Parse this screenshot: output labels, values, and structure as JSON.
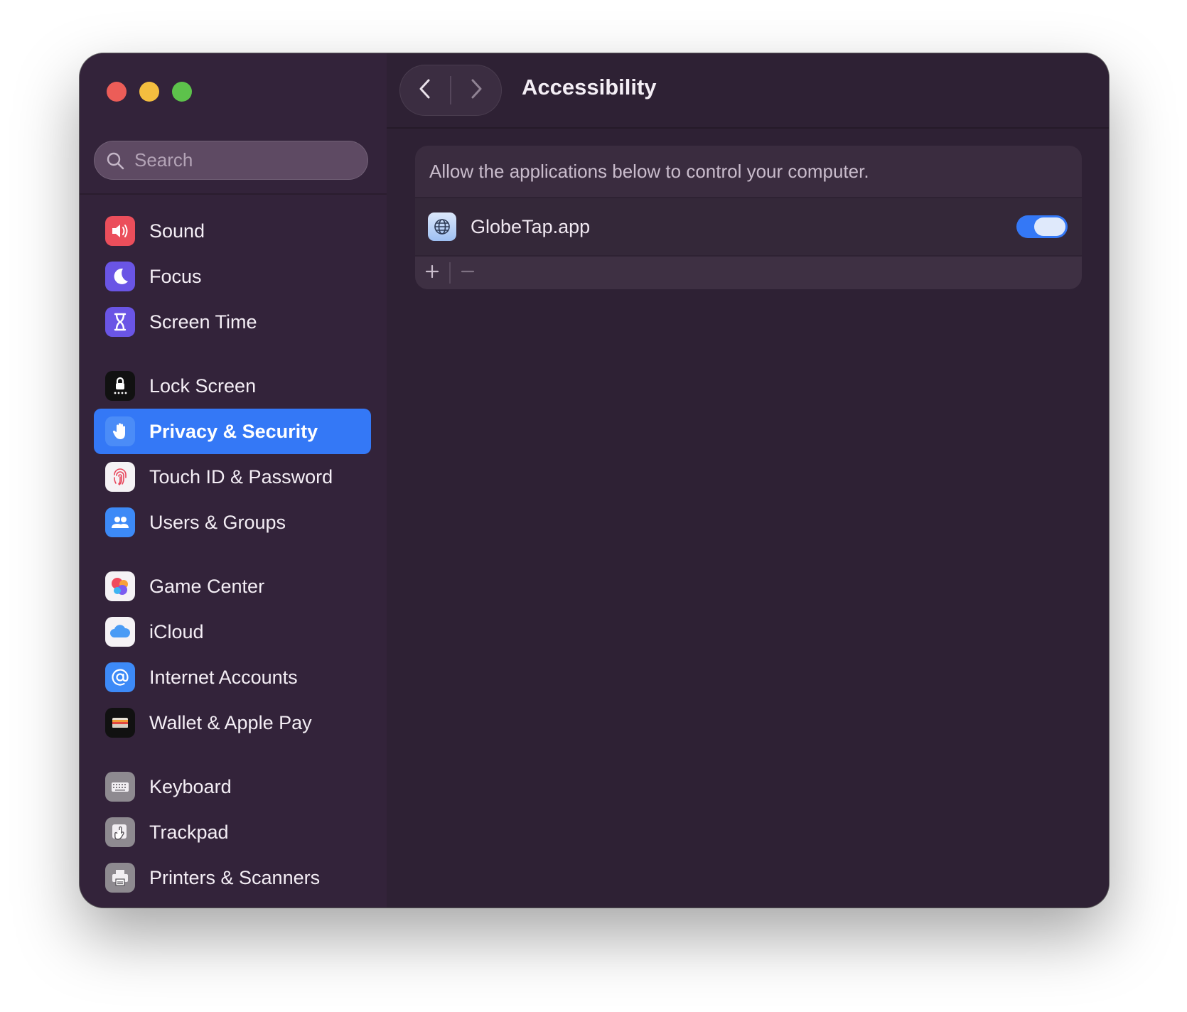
{
  "window": {
    "traffic_lights": [
      "close",
      "minimize",
      "zoom"
    ]
  },
  "search": {
    "placeholder": "Search",
    "value": ""
  },
  "sidebar": {
    "groups": [
      {
        "items": [
          {
            "label": "Sound",
            "icon": "speaker-icon",
            "color": "#eb4e5b"
          },
          {
            "label": "Focus",
            "icon": "moon-icon",
            "color": "#6a55e5"
          },
          {
            "label": "Screen Time",
            "icon": "hourglass-icon",
            "color": "#6a55e5"
          }
        ]
      },
      {
        "items": [
          {
            "label": "Lock Screen",
            "icon": "lock-icon",
            "color": "#1a1a1a"
          },
          {
            "label": "Privacy & Security",
            "icon": "hand-icon",
            "color": "#3478f6",
            "active": true
          },
          {
            "label": "Touch ID & Password",
            "icon": "fingerprint-icon",
            "color": "#f4f1f4"
          },
          {
            "label": "Users & Groups",
            "icon": "users-icon",
            "color": "#3d8af7"
          }
        ]
      },
      {
        "items": [
          {
            "label": "Game Center",
            "icon": "game-center-icon",
            "color": "#f4f1f4"
          },
          {
            "label": "iCloud",
            "icon": "cloud-icon",
            "color": "#f4f1f4"
          },
          {
            "label": "Internet Accounts",
            "icon": "at-icon",
            "color": "#3d8af7"
          },
          {
            "label": "Wallet & Apple Pay",
            "icon": "wallet-icon",
            "color": "#1a1a1a"
          }
        ]
      },
      {
        "items": [
          {
            "label": "Keyboard",
            "icon": "keyboard-icon",
            "color": "#8e8a90"
          },
          {
            "label": "Trackpad",
            "icon": "trackpad-icon",
            "color": "#8e8a90"
          },
          {
            "label": "Printers & Scanners",
            "icon": "printer-icon",
            "color": "#8e8a90"
          }
        ]
      }
    ]
  },
  "toolbar": {
    "back_icon": "chevron-left-icon",
    "forward_icon": "chevron-right-icon",
    "title": "Accessibility"
  },
  "panel": {
    "description": "Allow the applications below to control your computer.",
    "apps": [
      {
        "name": "GlobeTap.app",
        "icon": "globe-icon",
        "enabled": true
      }
    ],
    "add_icon": "plus-icon",
    "remove_icon": "minus-icon"
  },
  "colors": {
    "accent": "#3478f6",
    "window_bg": "#2e2134",
    "sidebar_bg": "#33233a"
  }
}
